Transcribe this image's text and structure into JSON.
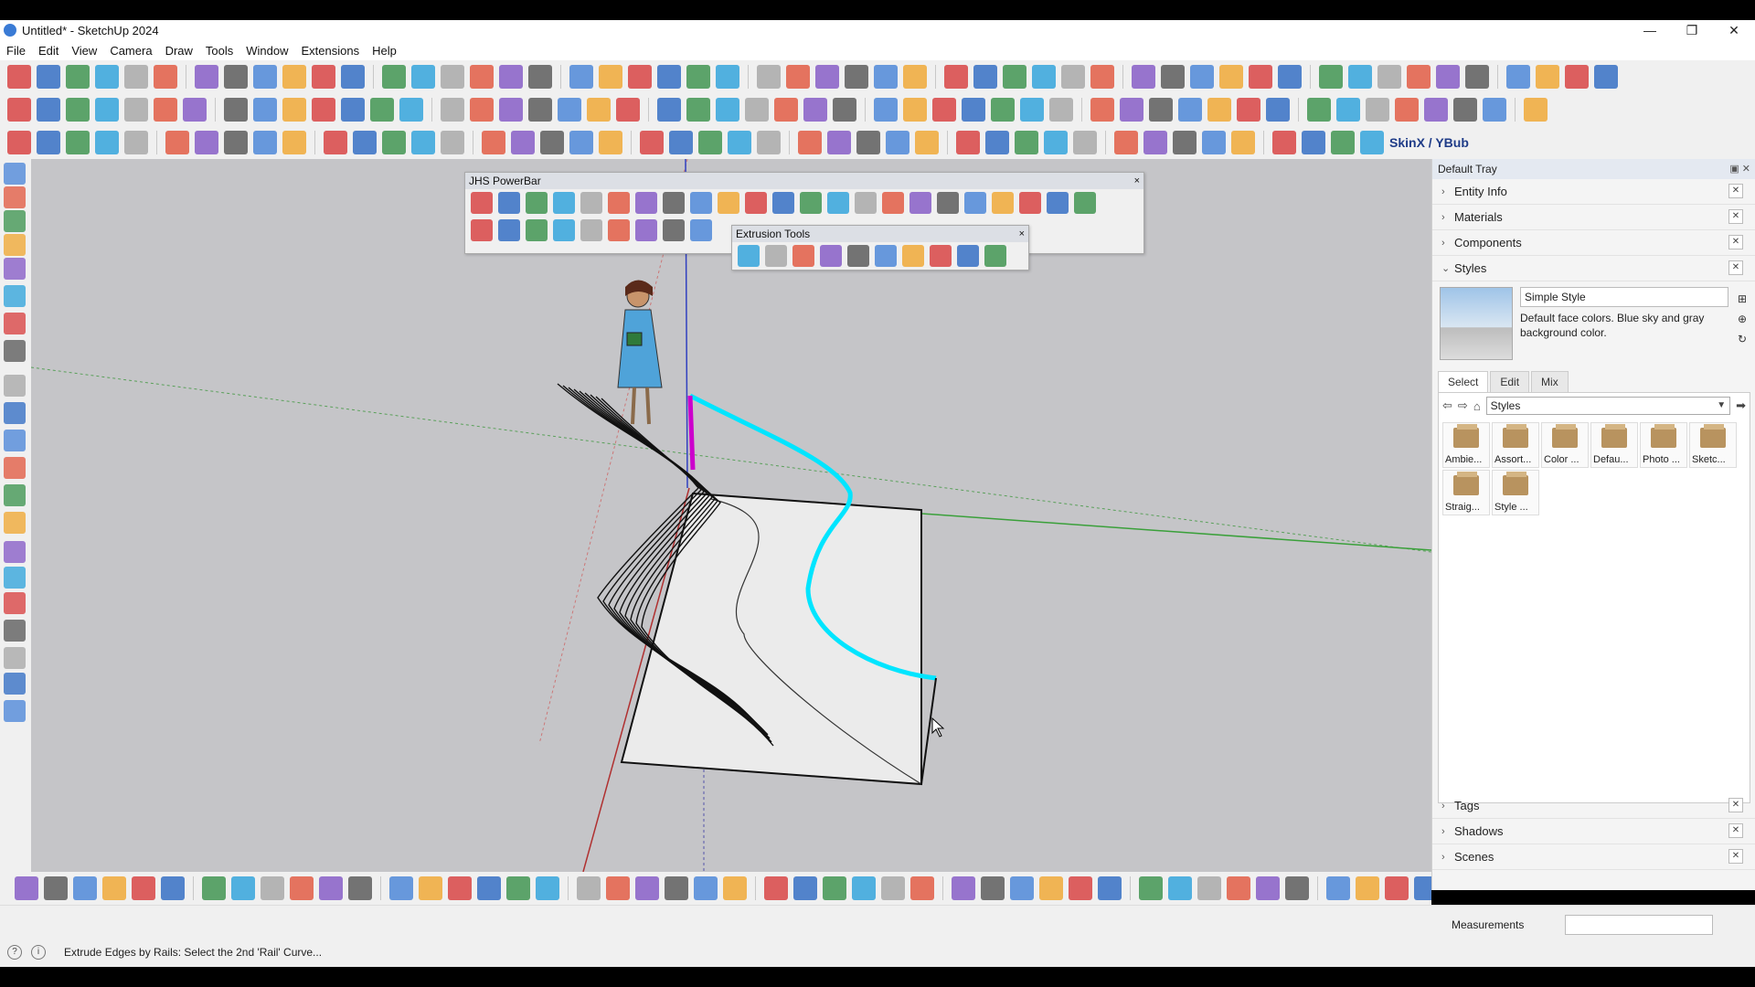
{
  "window": {
    "title": "Untitled* - SketchUp 2024",
    "controls": [
      "—",
      "❐",
      "✕"
    ]
  },
  "menu": [
    "File",
    "Edit",
    "View",
    "Camera",
    "Draw",
    "Tools",
    "Window",
    "Extensions",
    "Help"
  ],
  "toolbars": {
    "top_row_1_colors": [
      "#3a7bd5",
      "#e04a2f",
      "#2b8a3e",
      "#f0a020",
      "#7a4bc2",
      "#1c9bd9",
      "#d62f2f",
      "#4a4a4a",
      "#a0a0a0",
      "#1e5fbf"
    ],
    "skinx_label": "SkinX / YBub"
  },
  "floating_toolbars": {
    "powerbar_title": "JHS PowerBar",
    "extrusion_title": "Extrusion Tools",
    "close": "×"
  },
  "tray": {
    "title": "Default Tray",
    "panels_top": [
      {
        "label": "Entity Info"
      },
      {
        "label": "Materials"
      },
      {
        "label": "Components"
      },
      {
        "label": "Styles",
        "expanded": true
      }
    ],
    "style": {
      "name": "Simple Style",
      "description": "Default face colors. Blue sky and gray background color."
    },
    "tabs": [
      "Select",
      "Edit",
      "Mix"
    ],
    "active_tab": "Select",
    "collection_select": "Styles",
    "style_items": [
      "Ambie...",
      "Assort...",
      "Color ...",
      "Defau...",
      "Photo ...",
      "Sketc...",
      "Straig...",
      "Style ..."
    ],
    "panels_bottom": [
      {
        "label": "Tags"
      },
      {
        "label": "Shadows"
      },
      {
        "label": "Scenes"
      }
    ]
  },
  "status": {
    "text": "Extrude Edges by Rails: Select the 2nd 'Rail' Curve...",
    "measurements_label": "Measurements",
    "measurements_value": ""
  }
}
